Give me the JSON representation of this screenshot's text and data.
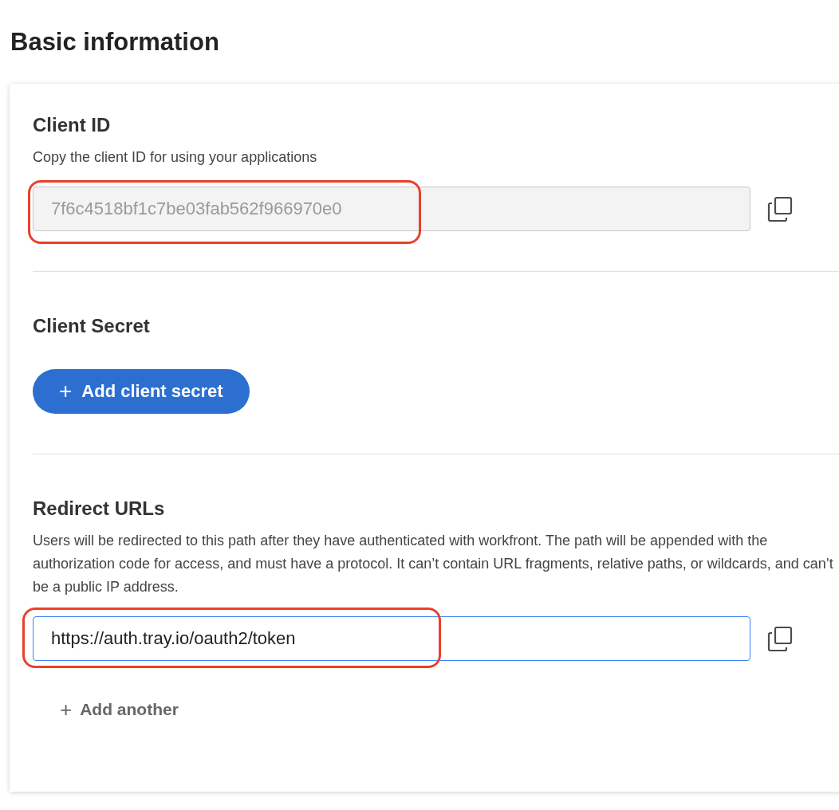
{
  "title": "Basic information",
  "sections": [
    {
      "kind": "field",
      "heading": "Client ID",
      "description": "Copy the client ID for using your applications",
      "field": {
        "value": "7f6c4518bf1c7be03fab562f966970e0",
        "disabled": true,
        "highlighted": true
      }
    },
    {
      "kind": "button",
      "heading": "Client Secret",
      "button": {
        "icon": "+",
        "label": "Add client secret"
      }
    },
    {
      "kind": "field",
      "heading": "Redirect URLs",
      "description": "Users will be redirected to this path after they have authenticated with workfront. The path will be appended with the authorization code for access, and must have a protocol. It can’t contain URL fragments, relative paths, or wildcards, and can’t be a public IP address.",
      "field": {
        "value": "https://auth.tray.io/oauth2/token",
        "disabled": false,
        "focused": true,
        "highlighted": true
      },
      "add_link": {
        "icon": "+",
        "label": "Add another"
      }
    }
  ]
}
